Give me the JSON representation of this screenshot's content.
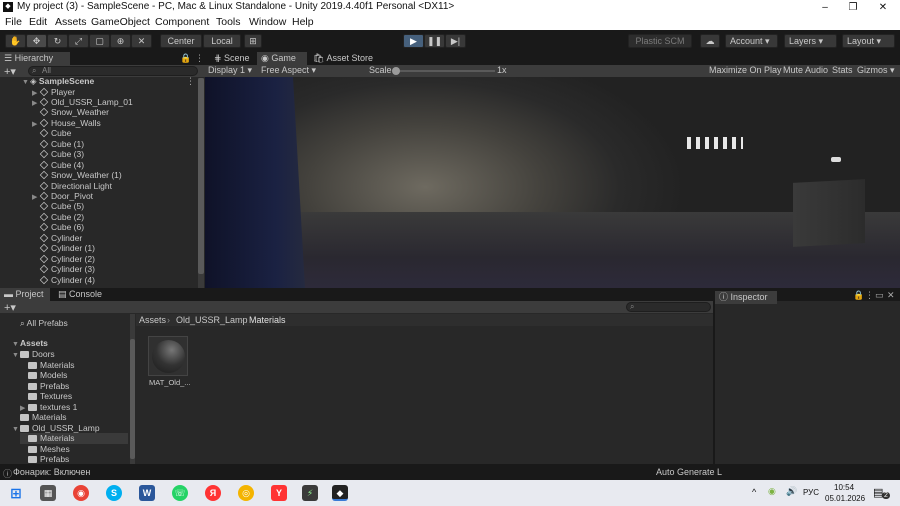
{
  "window": {
    "title": "My project (3) - SampleScene - PC, Mac & Linux Standalone - Unity 2019.4.40f1 Personal <DX11>",
    "minimize": "–",
    "maximize": "❐",
    "close": "✕"
  },
  "menu": [
    "File",
    "Edit",
    "Assets",
    "GameObject",
    "Component",
    "Tools",
    "Window",
    "Help"
  ],
  "toolbar": {
    "center": "Center",
    "local": "Local",
    "plastic": "Plastic SCM",
    "account": "Account",
    "layers": "Layers",
    "layout": "Layout"
  },
  "hierarchy": {
    "tab": "Hierarchy",
    "search": "All",
    "scene": "SampleScene",
    "items": [
      {
        "label": "Player",
        "arrow": true
      },
      {
        "label": "Old_USSR_Lamp_01",
        "arrow": true
      },
      {
        "label": "Snow_Weather",
        "arrow": false
      },
      {
        "label": "House_Walls",
        "arrow": true
      },
      {
        "label": "Cube",
        "arrow": false
      },
      {
        "label": "Cube (1)",
        "arrow": false
      },
      {
        "label": "Cube (3)",
        "arrow": false
      },
      {
        "label": "Cube (4)",
        "arrow": false
      },
      {
        "label": "Snow_Weather (1)",
        "arrow": false
      },
      {
        "label": "Directional Light",
        "arrow": false
      },
      {
        "label": "Door_Pivot",
        "arrow": true
      },
      {
        "label": "Cube (5)",
        "arrow": false
      },
      {
        "label": "Cube (2)",
        "arrow": false
      },
      {
        "label": "Cube (6)",
        "arrow": false
      },
      {
        "label": "Cylinder",
        "arrow": false
      },
      {
        "label": "Cylinder (1)",
        "arrow": false
      },
      {
        "label": "Cylinder (2)",
        "arrow": false
      },
      {
        "label": "Cylinder (3)",
        "arrow": false
      },
      {
        "label": "Cylinder (4)",
        "arrow": false
      }
    ]
  },
  "game": {
    "tabs": [
      "Scene",
      "Game",
      "Asset Store"
    ],
    "display": "Display 1",
    "aspect": "Free Aspect",
    "scale_label": "Scale",
    "scale_value": "1x",
    "maximize": "Maximize On Play",
    "mute": "Mute Audio",
    "stats": "Stats",
    "gizmos": "Gizmos"
  },
  "project": {
    "tabs": [
      "Project",
      "Console"
    ],
    "all_prefabs": "All Prefabs",
    "assets": "Assets",
    "tree": [
      {
        "label": "Doors",
        "indent": 1,
        "arrow": "▼"
      },
      {
        "label": "Materials",
        "indent": 2,
        "arrow": ""
      },
      {
        "label": "Models",
        "indent": 2,
        "arrow": ""
      },
      {
        "label": "Prefabs",
        "indent": 2,
        "arrow": ""
      },
      {
        "label": "Textures",
        "indent": 2,
        "arrow": ""
      },
      {
        "label": "textures 1",
        "indent": 2,
        "arrow": "▶"
      },
      {
        "label": "Materials",
        "indent": 1,
        "arrow": ""
      },
      {
        "label": "Old_USSR_Lamp",
        "indent": 1,
        "arrow": "▼"
      },
      {
        "label": "Materials",
        "indent": 2,
        "arrow": "",
        "selected": true
      },
      {
        "label": "Meshes",
        "indent": 2,
        "arrow": ""
      },
      {
        "label": "Prefabs",
        "indent": 2,
        "arrow": ""
      }
    ],
    "breadcrumb": [
      "Assets",
      "Old_USSR_Lamp",
      "Materials"
    ],
    "asset_label": "MAT_Old_..."
  },
  "inspector": {
    "tab": "Inspector"
  },
  "status": {
    "message": "Фонарик: Включен",
    "right": "Auto Generate L"
  },
  "taskbar": {
    "lang": "РУС",
    "time": "10:54",
    "date": "05.01.2026",
    "notif": "2"
  }
}
